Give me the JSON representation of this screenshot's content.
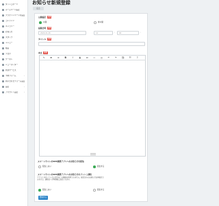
{
  "sidebar": {
    "items": [
      {
        "label": "ダッシュボード",
        "icon": "home-icon",
        "arrow": ""
      },
      {
        "label": "ホームページ設定",
        "icon": "globe-icon",
        "arrow": ""
      },
      {
        "label": "プラグインページの設定",
        "icon": "plugin-icon",
        "arrow": "›"
      },
      {
        "label": "コンテンツ",
        "icon": "file-icon",
        "arrow": ""
      },
      {
        "label": "ギャラリー",
        "icon": "image-icon",
        "arrow": ""
      },
      {
        "label": "お知らせ",
        "icon": "bell-icon",
        "arrow": ""
      },
      {
        "label": "スタッフ",
        "icon": "person-icon",
        "arrow": ""
      },
      {
        "label": "メニュー",
        "icon": "list-icon",
        "arrow": ""
      },
      {
        "label": "動画",
        "icon": "video-icon",
        "arrow": ""
      },
      {
        "label": "ブログ",
        "icon": "pen-icon",
        "arrow": ""
      },
      {
        "label": "クーポン",
        "icon": "ticket-icon",
        "arrow": ""
      },
      {
        "label": "ニュースレター",
        "icon": "mail-icon",
        "arrow": ""
      },
      {
        "label": "外部サービス",
        "icon": "link-icon",
        "arrow": ""
      },
      {
        "label": "予約フォーム",
        "icon": "calendar-icon",
        "arrow": "›"
      },
      {
        "label": "問い合わせフォーム設定",
        "icon": "form-icon",
        "arrow": "›"
      },
      {
        "label": "設定",
        "icon": "gear-icon",
        "arrow": "›"
      },
      {
        "label": "アカウント設定",
        "icon": "user-icon",
        "arrow": "›"
      }
    ]
  },
  "page": {
    "title": "お知らせ新規登録",
    "back_label": "戻る"
  },
  "form": {
    "required_badge": "必須",
    "public_setting": {
      "label": "公開設定",
      "options": [
        "公開",
        "非公開"
      ]
    },
    "publish_date": {
      "label": "投稿日時",
      "date_value": "2024-01-26",
      "hour_value": "12",
      "minute_value": "00",
      "sep1": ":",
      "sep2": ":"
    },
    "title_field": {
      "label": "タイトル",
      "value": ""
    },
    "body": {
      "label": "本文"
    },
    "toolbar": [
      "✎",
      "⊞",
      "≡",
      "B",
      "I",
      "S",
      "⊡",
      "▭",
      "◫",
      "↶",
      "↷",
      "⛓",
      "☷",
      "?"
    ],
    "sns_share": {
      "label": "スマートサイトのSNS連携アプリへのお知らせを配信",
      "options": [
        "配信しない",
        "配信する"
      ]
    },
    "newsletter": {
      "label": "スマートサイトのSNS連携アプリへのお知らせのプッシュ通知",
      "notice": "アプリに対応していない場合はこの機能は利用できません。配信済みのお知らせは再配信できません。通知は一定時間後に送信されます。",
      "options": [
        "配信しない",
        "配信する"
      ]
    },
    "submit_label": "登録する"
  },
  "colors": {
    "accent": "#2e86c9",
    "radio_on": "#3aaa55",
    "required": "#e0483f"
  }
}
